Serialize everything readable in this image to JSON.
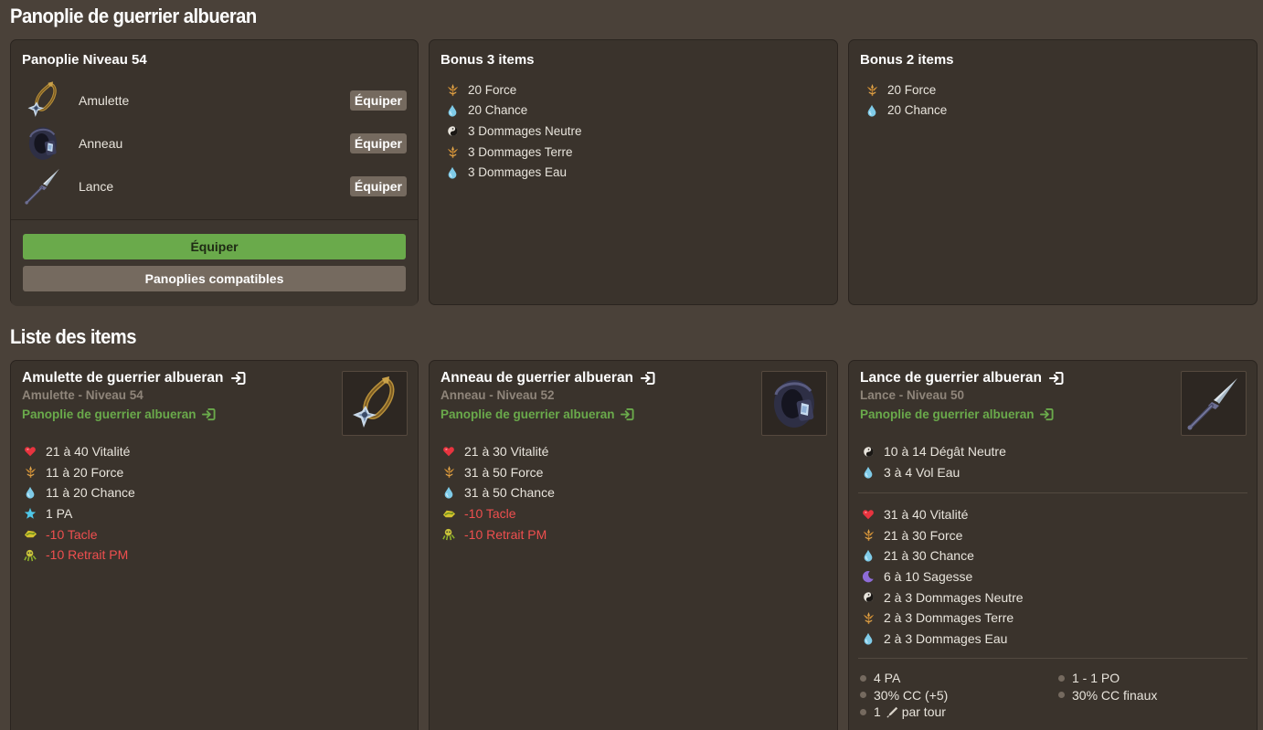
{
  "titles": {
    "set": "Panoplie de guerrier albueran",
    "items": "Liste des items"
  },
  "set_card": {
    "title": "Panoplie Niveau 54",
    "items": [
      {
        "name": "Amulette",
        "button": "Équiper",
        "icon": "amulet-icon"
      },
      {
        "name": "Anneau",
        "button": "Équiper",
        "icon": "ring-icon"
      },
      {
        "name": "Lance",
        "button": "Équiper",
        "icon": "spear-icon"
      }
    ],
    "equip_all": "Équiper",
    "compatible": "Panoplies compatibles"
  },
  "bonus3": {
    "title": "Bonus 3 items",
    "stats": [
      {
        "text": "20 Force",
        "icon": "force-icon"
      },
      {
        "text": "20 Chance",
        "icon": "chance-icon"
      },
      {
        "text": "3 Dommages Neutre",
        "icon": "neutral-icon"
      },
      {
        "text": "3 Dommages Terre",
        "icon": "force-icon"
      },
      {
        "text": "3 Dommages Eau",
        "icon": "chance-icon"
      }
    ]
  },
  "bonus2": {
    "title": "Bonus 2 items",
    "stats": [
      {
        "text": "20 Force",
        "icon": "force-icon"
      },
      {
        "text": "20 Chance",
        "icon": "chance-icon"
      }
    ]
  },
  "items": [
    {
      "name": "Amulette de guerrier albueran",
      "sub": "Amulette - Niveau 54",
      "set": "Panoplie de guerrier albueran",
      "stats": [
        {
          "text": "21 à 40 Vitalité",
          "icon": "heart-icon",
          "neg": false
        },
        {
          "text": "11 à 20 Force",
          "icon": "force-icon",
          "neg": false
        },
        {
          "text": "11 à 20 Chance",
          "icon": "chance-icon",
          "neg": false
        },
        {
          "text": "1 PA",
          "icon": "star-icon",
          "neg": false
        },
        {
          "text": "-10 Tacle",
          "icon": "tackle-icon",
          "neg": true
        },
        {
          "text": "-10 Retrait PM",
          "icon": "mp-reduction-icon",
          "neg": true
        }
      ]
    },
    {
      "name": "Anneau de guerrier albueran",
      "sub": "Anneau - Niveau 52",
      "set": "Panoplie de guerrier albueran",
      "stats": [
        {
          "text": "21 à 30 Vitalité",
          "icon": "heart-icon",
          "neg": false
        },
        {
          "text": "31 à 50 Force",
          "icon": "force-icon",
          "neg": false
        },
        {
          "text": "31 à 50 Chance",
          "icon": "chance-icon",
          "neg": false
        },
        {
          "text": "-10 Tacle",
          "icon": "tackle-icon",
          "neg": true
        },
        {
          "text": "-10 Retrait PM",
          "icon": "mp-reduction-icon",
          "neg": true
        }
      ]
    },
    {
      "name": "Lance de guerrier albueran",
      "sub": "Lance - Niveau 50",
      "set": "Panoplie de guerrier albueran",
      "damage": [
        {
          "text": "10 à 14 Dégât Neutre",
          "icon": "neutral-icon"
        },
        {
          "text": "3 à 4 Vol Eau",
          "icon": "chance-icon"
        }
      ],
      "stats": [
        {
          "text": "31 à 40 Vitalité",
          "icon": "heart-icon",
          "neg": false
        },
        {
          "text": "21 à 30 Force",
          "icon": "force-icon",
          "neg": false
        },
        {
          "text": "21 à 30 Chance",
          "icon": "chance-icon",
          "neg": false
        },
        {
          "text": "6 à 10 Sagesse",
          "icon": "wisdom-icon",
          "neg": false
        },
        {
          "text": "2 à 3 Dommages Neutre",
          "icon": "neutral-icon",
          "neg": false
        },
        {
          "text": "2 à 3 Dommages Terre",
          "icon": "force-icon",
          "neg": false
        },
        {
          "text": "2 à 3 Dommages Eau",
          "icon": "chance-icon",
          "neg": false
        }
      ],
      "weapon": {
        "pa": "4 PA",
        "po": "1 - 1 PO",
        "cc": "30% CC (+5)",
        "cc_final": "30% CC finaux",
        "per_turn_count": "1",
        "per_turn_label": "par tour"
      }
    }
  ],
  "colors": {
    "background": "#4a4139",
    "card": "#3a332c",
    "green": "#6aaa4b",
    "negative": "#ef4f4f",
    "muted": "#8f857a"
  }
}
